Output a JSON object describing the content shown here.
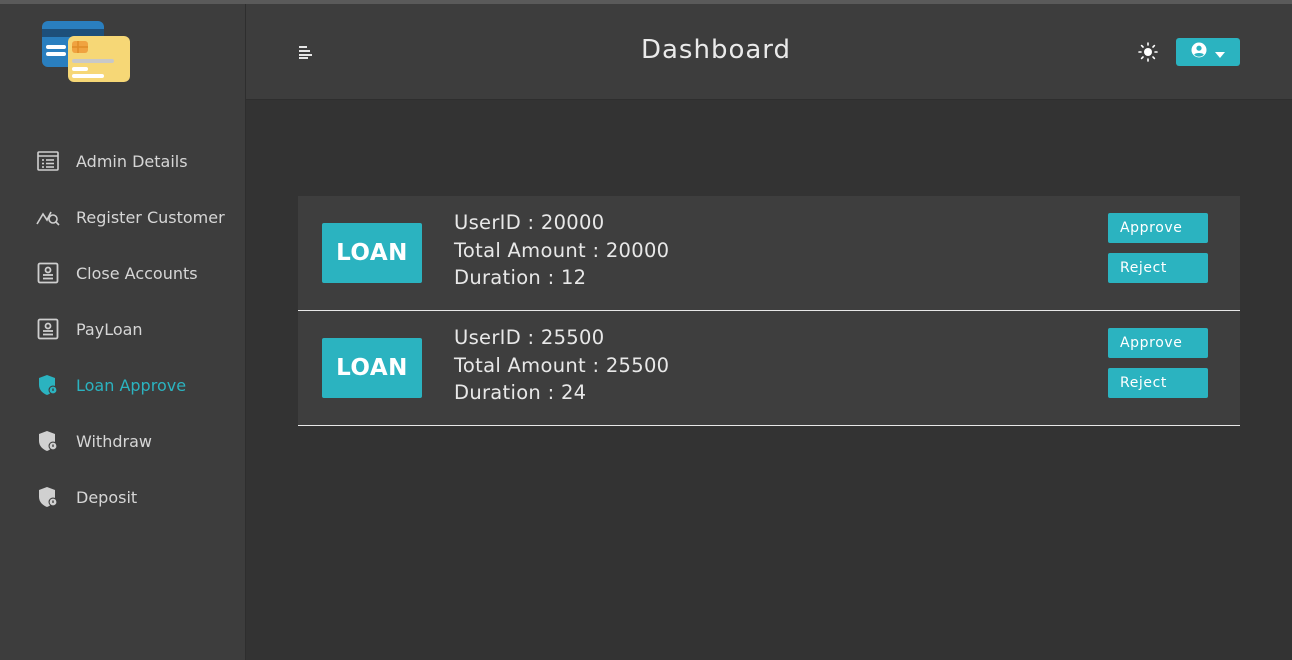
{
  "header": {
    "title": "Dashboard"
  },
  "sidebar": {
    "items": [
      {
        "label": "Admin Details",
        "icon": "list-icon"
      },
      {
        "label": "Register Customer",
        "icon": "chart-search-icon"
      },
      {
        "label": "Close Accounts",
        "icon": "contact-card-icon"
      },
      {
        "label": "PayLoan",
        "icon": "contact-card-icon"
      },
      {
        "label": "Loan Approve",
        "icon": "shield-icon",
        "active": true
      },
      {
        "label": "Withdraw",
        "icon": "shield-icon"
      },
      {
        "label": "Deposit",
        "icon": "shield-icon"
      }
    ]
  },
  "loans": [
    {
      "badge": "LOAN",
      "user_id": "UserID : 20000",
      "total_amount": "Total Amount : 20000",
      "duration": "Duration : 12",
      "approve_label": "Approve",
      "reject_label": "Reject"
    },
    {
      "badge": "LOAN",
      "user_id": "UserID : 25500",
      "total_amount": "Total Amount : 25500",
      "duration": "Duration : 24",
      "approve_label": "Approve",
      "reject_label": "Reject"
    }
  ],
  "colors": {
    "accent": "#2bb3c0",
    "background": "#333333",
    "panel": "#3d3d3d"
  }
}
